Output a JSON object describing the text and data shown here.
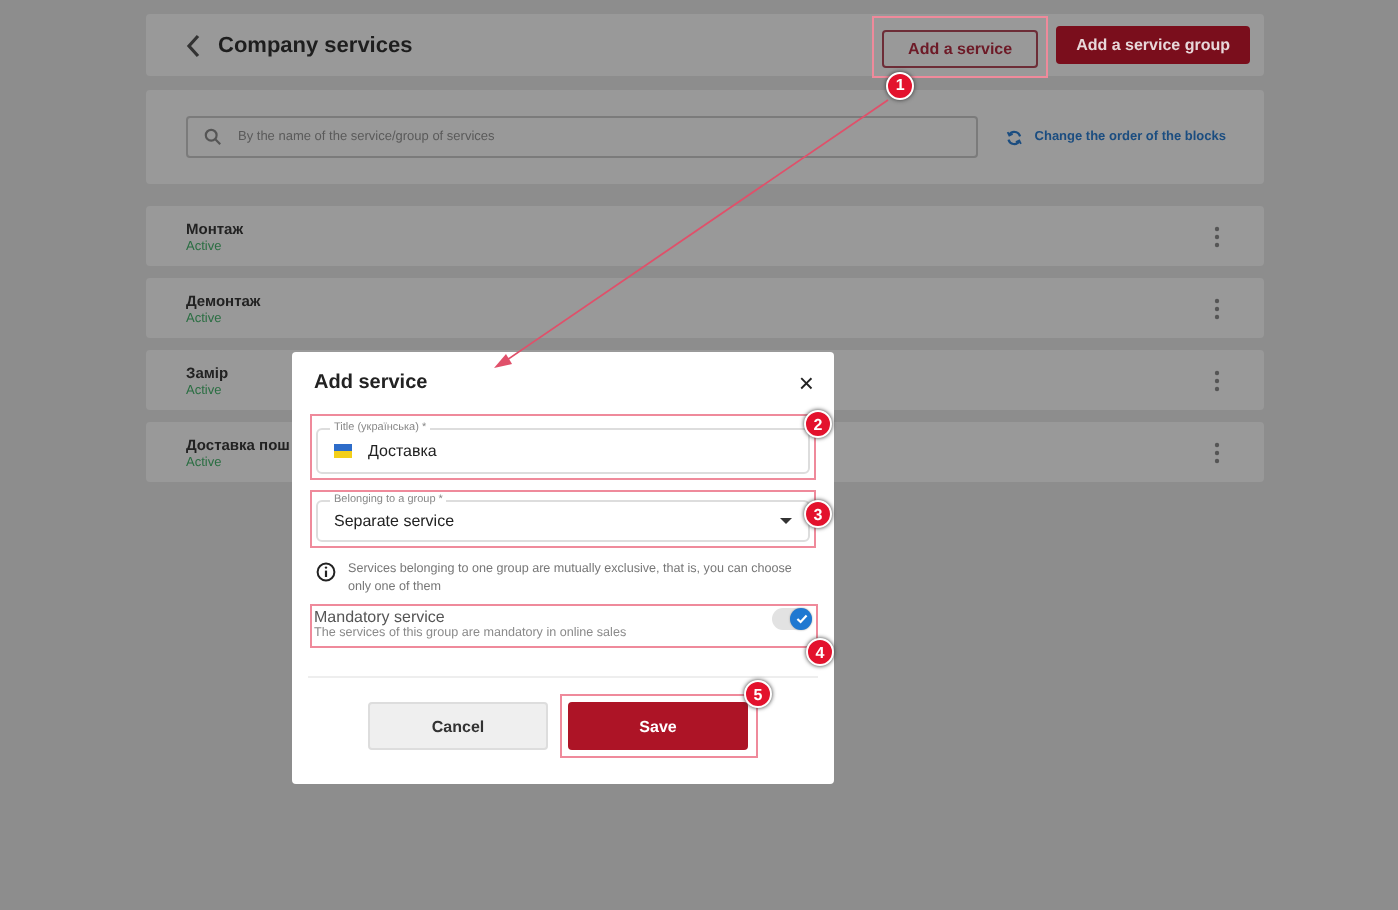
{
  "header": {
    "back_icon": true,
    "title": "Company services",
    "buttons": [
      {
        "label": "Add a service",
        "kind": "outline"
      },
      {
        "label": "Add a service group",
        "kind": "filled"
      }
    ]
  },
  "search": {
    "placeholder": "By the name of the service/group of services",
    "reorder_link": "Change the order of the blocks"
  },
  "services": [
    {
      "name": "Монтаж",
      "status": "Active"
    },
    {
      "name": "Демонтаж",
      "status": "Active"
    },
    {
      "name": "Замір",
      "status": "Active"
    },
    {
      "name": "Доставка пош",
      "status": "Active"
    }
  ],
  "dialog": {
    "title": "Add service",
    "close": "×",
    "title_field": {
      "label": "Title (українська) *",
      "value": "Доставка"
    },
    "group_field": {
      "label": "Belonging to a group *",
      "value": "Separate service"
    },
    "info": "Services belonging to one group are mutually exclusive, that is, you can choose only one of them",
    "mandatory": {
      "label": "Mandatory service",
      "description": "The services of this group are mandatory in online sales",
      "on": true
    },
    "buttons": [
      {
        "label": "Cancel",
        "kind": "secondary"
      },
      {
        "label": "Save",
        "kind": "primary"
      }
    ]
  },
  "annotations": [
    {
      "label": "1"
    },
    {
      "label": "2"
    },
    {
      "label": "3"
    },
    {
      "label": "4"
    },
    {
      "label": "5"
    }
  ]
}
